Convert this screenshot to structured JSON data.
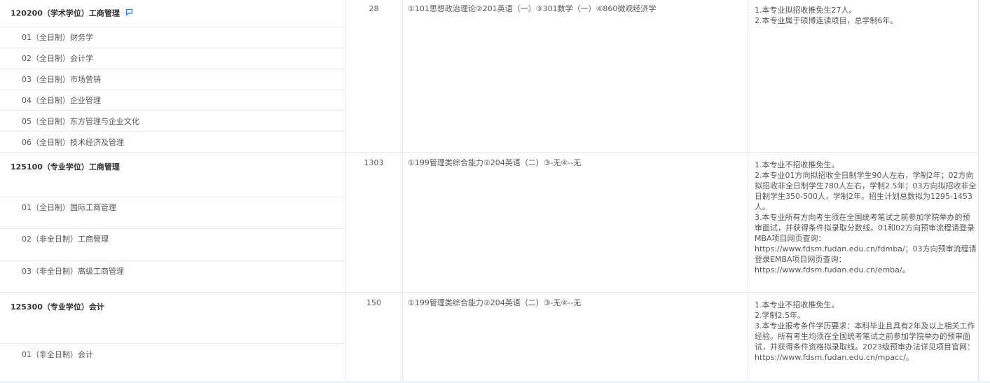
{
  "rows": [
    {
      "title": "120200（学术学位）工商管理",
      "count": "28",
      "exam": "①101思想政治理论②201英语（一）③301数学（一）④860微观经济学",
      "directions": [
        "01（全日制）财务学",
        "02（全日制）会计学",
        "03（全日制）市场营销",
        "04（全日制）企业管理",
        "05（全日制）东方管理与企业文化",
        "06（全日制）技术经济及管理"
      ],
      "notes": [
        "1.本专业拟招收推免生27人。",
        "2.本专业属于硕博连读项目，总学制6年。"
      ]
    },
    {
      "title": "125100（专业学位）工商管理",
      "count": "1303",
      "exam": "①199管理类综合能力②204英语（二）③-无④--无",
      "directions": [
        "01（全日制）国际工商管理",
        "02（非全日制）工商管理",
        "03（非全日制）高级工商管理"
      ],
      "notes": [
        "1.本专业不招收推免生。",
        "2.本专业01方向拟招收全日制学生90人左右，学制2年；02方向拟招收非全日制学生780人左右，学制2.5年；03方向拟招收非全日制学生350-500人，学制2年。招生计划总数拟为1295-1453人。",
        "3.本专业所有方向考生须在全国统考笔试之前参加学院举办的预审面试，并获得条件拟录取分数线。01和02方向预审流程请登录MBA项目网页查询：https://www.fdsm.fudan.edu.cn/fdmba/；03方向预审流程请登录EMBA项目网页查询：https://www.fdsm.fudan.edu.cn/emba/。"
      ]
    },
    {
      "title": "125300（专业学位）会计",
      "count": "150",
      "exam": "①199管理类综合能力②204英语（二）③-无④--无",
      "directions": [
        "01（非全日制）会计"
      ],
      "notes": [
        "1.本专业不招收推免生。",
        "2.学制2.5年。",
        "3.本专业报考条件学历要求：本科毕业且具有2年及以上相关工作经验。所有考生均须在全国统考笔试之前参加学院举办的预审面试，并获得条件资格拟录取线。2023级预审办法详见项目官网：https://www.fdsm.fudan.edu.cn/mpacc/。"
      ]
    }
  ],
  "colors": {
    "flag": "#1e78ff",
    "border": "#e8e8e8"
  },
  "icons": {
    "flag": "message-flag-icon"
  }
}
